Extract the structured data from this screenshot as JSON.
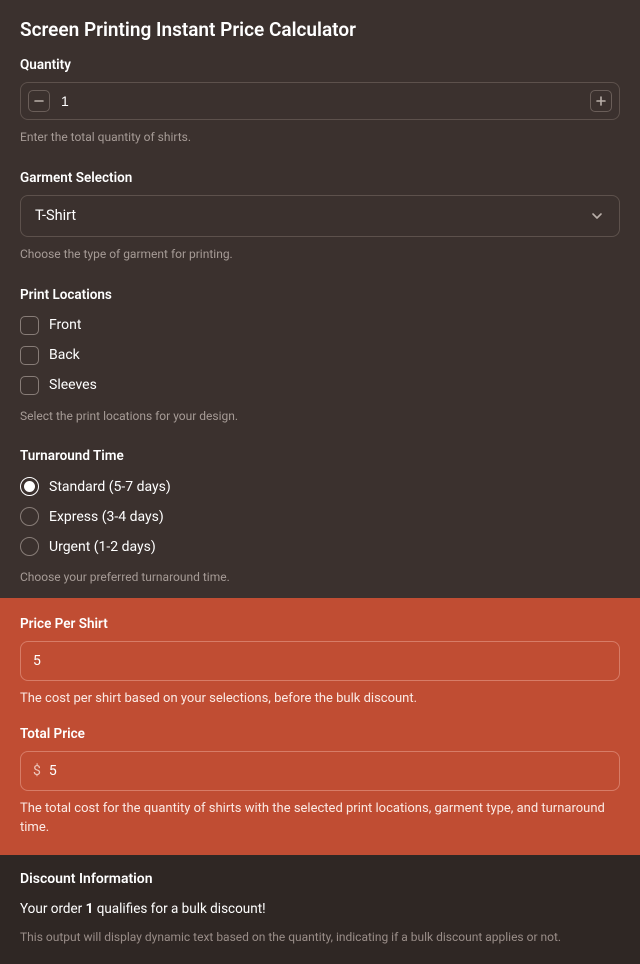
{
  "title": "Screen Printing Instant Price Calculator",
  "quantity": {
    "label": "Quantity",
    "value": "1",
    "helper": "Enter the total quantity of shirts."
  },
  "garment": {
    "label": "Garment Selection",
    "value": "T-Shirt",
    "helper": "Choose the type of garment for printing."
  },
  "locations": {
    "label": "Print Locations",
    "options": [
      {
        "label": "Front",
        "checked": false
      },
      {
        "label": "Back",
        "checked": false
      },
      {
        "label": "Sleeves",
        "checked": false
      }
    ],
    "helper": "Select the print locations for your design."
  },
  "turnaround": {
    "label": "Turnaround Time",
    "options": [
      {
        "label": "Standard (5-7 days)",
        "selected": true
      },
      {
        "label": "Express (3-4 days)",
        "selected": false
      },
      {
        "label": "Urgent (1-2 days)",
        "selected": false
      }
    ],
    "helper": "Choose your preferred turnaround time."
  },
  "pricePerShirt": {
    "label": "Price Per Shirt",
    "value": "5",
    "helper": "The cost per shirt based on your selections, before the bulk discount."
  },
  "totalPrice": {
    "label": "Total Price",
    "prefix": "$",
    "value": "5",
    "helper": "The total cost for the quantity of shirts with the selected print locations, garment type, and turnaround time."
  },
  "discount": {
    "label": "Discount Information",
    "pre": "Your order ",
    "qty": "1",
    "post": " qualifies for a bulk discount!",
    "helper": "This output will display dynamic text based on the quantity, indicating if a bulk discount applies or not."
  }
}
